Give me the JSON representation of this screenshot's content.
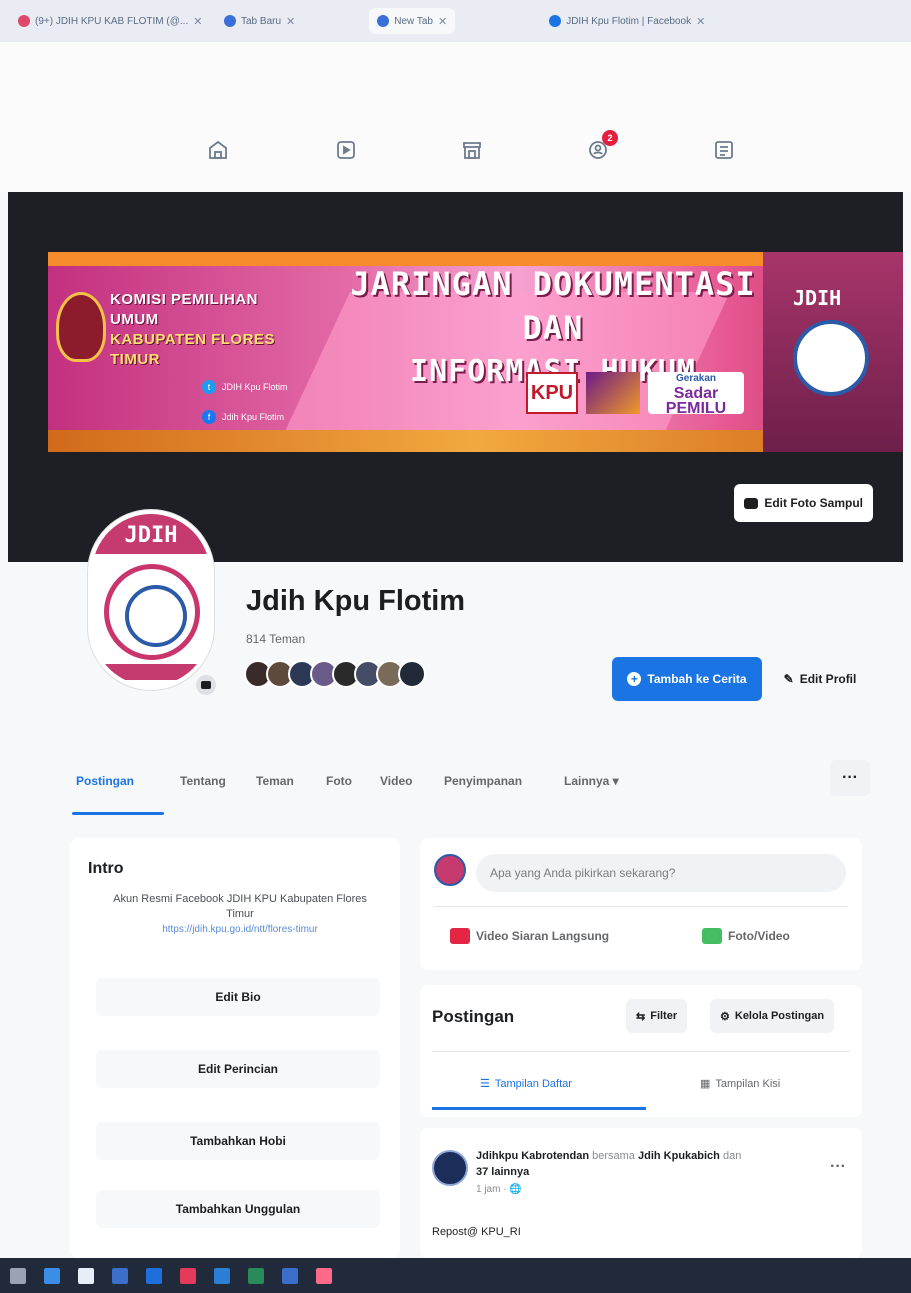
{
  "browser": {
    "tabs": [
      {
        "label": "(9+) JDIH KPU KAB FLOTIM (@...",
        "color": "#e04a6a",
        "active": false
      },
      {
        "label": "Tab Baru",
        "color": "#3b6fd8",
        "active": false
      },
      {
        "label": "New Tab",
        "color": "#3b6fd8",
        "active": true
      },
      {
        "label": "JDIH Kpu Flotim | Facebook",
        "color": "#1b74e4",
        "active": false
      }
    ]
  },
  "topnav": {
    "notification_count": "2"
  },
  "cover": {
    "org_line1": "KOMISI PEMILIHAN UMUM",
    "org_line2": "KABUPATEN FLORES TIMUR",
    "title_line1": "JARINGAN DOKUMENTASI DAN",
    "title_line2": "INFORMASI HUKUM",
    "twitter": "JDIH Kpu Flotim",
    "facebook": "Jdih Kpu Flotim",
    "kpu_badge": "KPU",
    "sadar_small": "Gerakan",
    "sadar_line1": "Sadar",
    "sadar_line2": "PEMILU",
    "jdih_mark": "JDIH",
    "edit_cover_label": "Edit Foto Sampul"
  },
  "profile": {
    "avatar_text": "JDIH",
    "name": "Jdih Kpu Flotim",
    "friends": "814 Teman",
    "face_colors": [
      "#3a2a2a",
      "#5e4a3c",
      "#2b3856",
      "#6a5a8a",
      "#2a2a2a",
      "#444c66",
      "#7a6a5a",
      "#222a3a"
    ],
    "add_story": "Tambah ke Cerita",
    "edit_profile": "Edit Profil"
  },
  "tabs": {
    "items": [
      "Postingan",
      "Tentang",
      "Teman",
      "Foto",
      "Video",
      "Penyimpanan",
      "Lainnya ▾"
    ],
    "more": "···"
  },
  "intro": {
    "title": "Intro",
    "bio": "Akun Resmi Facebook JDIH KPU Kabupaten Flores Timur",
    "link": "https://jdih.kpu.go.id/ntt/flores-timur",
    "buttons": [
      "Edit Bio",
      "Edit Perincian",
      "Tambahkan Hobi",
      "Tambahkan Unggulan"
    ]
  },
  "composer": {
    "placeholder": "Apa yang Anda pikirkan sekarang?",
    "live": "Video Siaran Langsung",
    "photo": "Foto/Video"
  },
  "posts": {
    "title": "Postingan",
    "filter": "Filter",
    "manage": "Kelola Postingan",
    "list_view": "Tampilan Daftar",
    "grid_view": "Tampilan Kisi"
  },
  "post": {
    "author": "Jdihkpu Kabrotendan",
    "with": "bersama",
    "tagged": "Jdih Kpukabich",
    "others": "dan",
    "others_count": "37 lainnya",
    "time": "1 jam · 🌐",
    "text": "Repost@ KPU_RI",
    "dots": "···"
  },
  "taskbar": {
    "apps": [
      "#9aa3b3",
      "#3a8ee6",
      "#e8eef8",
      "#3a6ec8",
      "#1e6fd9",
      "#e53a5a",
      "#2a7fd4",
      "#2b8a5a",
      "#3a6ec8",
      "#ff6a8a"
    ]
  }
}
